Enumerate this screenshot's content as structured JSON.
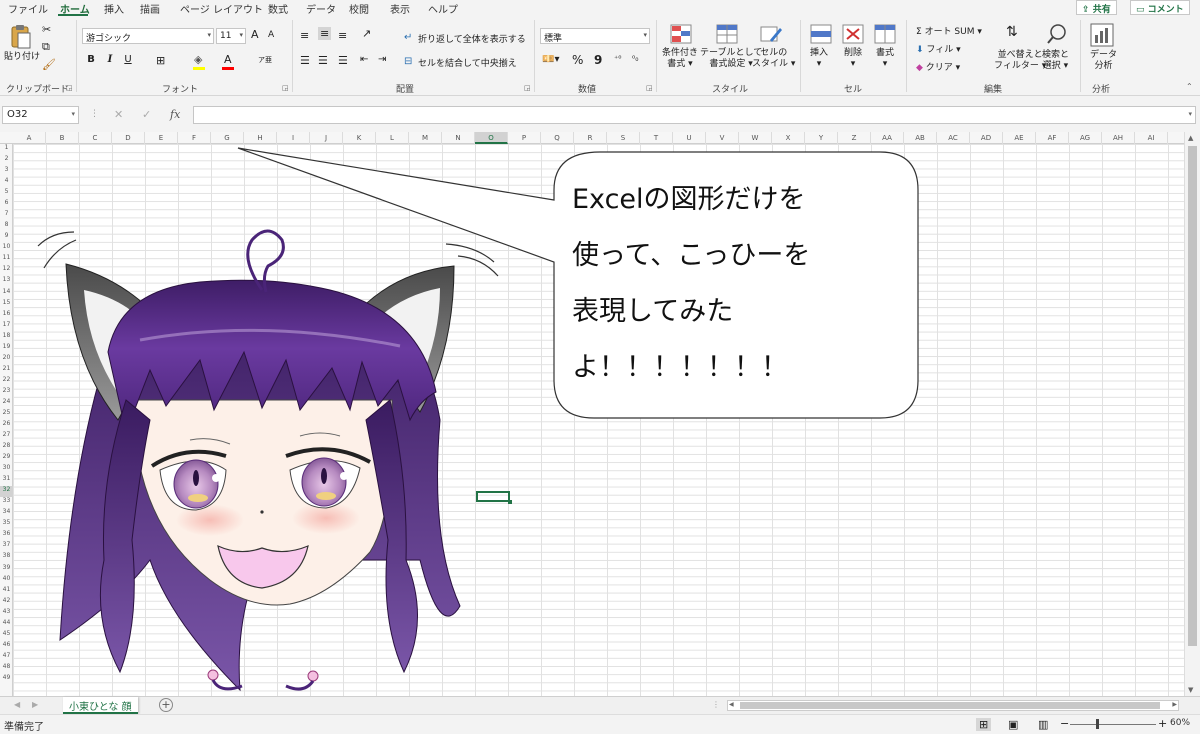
{
  "tabs": [
    "ファイル",
    "ホーム",
    "挿入",
    "描画",
    "ページ レイアウト",
    "数式",
    "データ",
    "校閲",
    "表示",
    "ヘルプ"
  ],
  "share_label": "共有",
  "comment_label": "コメント",
  "ribbon": {
    "clipboard": {
      "paste": "貼り付け",
      "label": "クリップボード"
    },
    "font": {
      "name": "游ゴシック",
      "size": "11",
      "label": "フォント",
      "bold": "B",
      "italic": "I",
      "underline": "U",
      "grow": "A",
      "shrink": "A"
    },
    "alignment": {
      "wrap": "折り返して全体を表示する",
      "merge": "セルを結合して中央揃え",
      "label": "配置"
    },
    "number": {
      "format": "標準",
      "label": "数値",
      "percent": "%",
      "comma": "9"
    },
    "styles": {
      "conditional": "条件付き",
      "conditional2": "書式",
      "table": "テーブルとして",
      "table2": "書式設定",
      "cell": "セルの",
      "cell2": "スタイル",
      "label": "スタイル"
    },
    "cells": {
      "insert": "挿入",
      "delete": "削除",
      "format": "書式",
      "label": "セル"
    },
    "editing": {
      "autosum": "オート SUM",
      "fill": "フィル",
      "clear": "クリア",
      "sort": "並べ替えと",
      "sort2": "フィルター",
      "find": "検索と",
      "find2": "選択",
      "label": "編集"
    },
    "analysis": {
      "data": "データ",
      "data2": "分析",
      "label": "分析"
    }
  },
  "formula_bar": {
    "name_box": "O32",
    "fx": "fx",
    "value": ""
  },
  "columns": [
    "A",
    "B",
    "C",
    "D",
    "E",
    "F",
    "G",
    "H",
    "I",
    "J",
    "K",
    "L",
    "M",
    "N",
    "O",
    "P",
    "Q",
    "R",
    "S",
    "T",
    "U",
    "V",
    "W",
    "X",
    "Y",
    "Z",
    "AA",
    "AB",
    "AC",
    "AD",
    "AE",
    "AF",
    "AG",
    "AH",
    "AI"
  ],
  "selected_column": "O",
  "selected_row": 32,
  "row_count": 49,
  "speech_bubble": {
    "lines": [
      "Excelの図形だけを",
      "使って、こっひーを",
      "表現してみた",
      "よ！！！！！！！"
    ]
  },
  "sheet_tab": "小東ひとな 顔",
  "status": "準備完了",
  "zoom": "60%",
  "colors": {
    "accent": "#217346",
    "hair": "#5a2d8a",
    "skin": "#fdebe1"
  }
}
